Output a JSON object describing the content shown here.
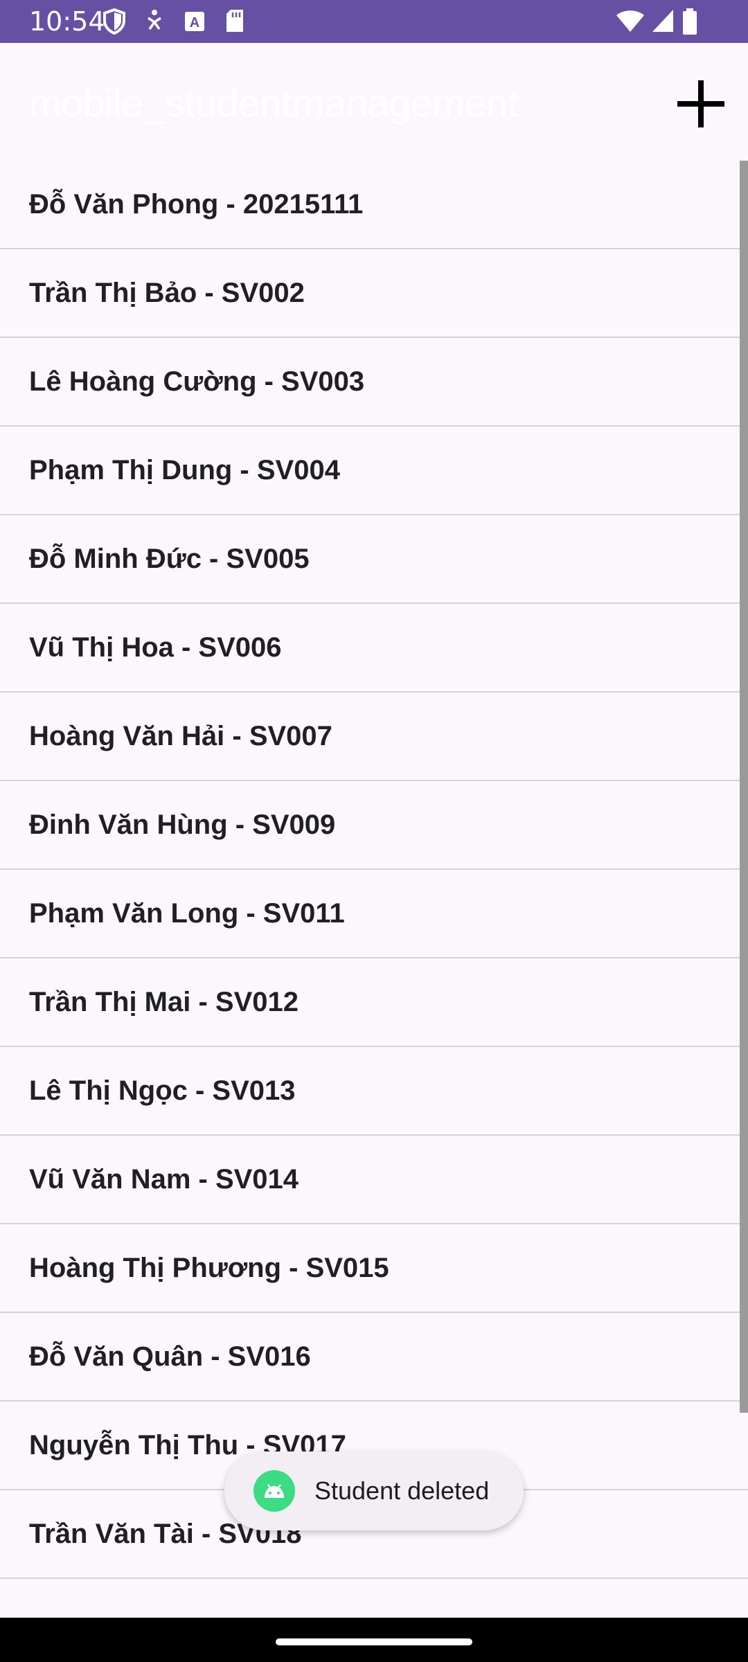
{
  "status_bar": {
    "time": "10:54",
    "left_icons": [
      "shield-icon",
      "accessibility-icon",
      "keyboard-a-icon",
      "sd-card-icon"
    ],
    "right_icons": [
      "wifi-icon",
      "signal-icon",
      "battery-icon"
    ],
    "background": "#6650a4"
  },
  "app_bar": {
    "title": "mobile_studentmanagement",
    "add_icon": "plus-icon"
  },
  "students": [
    {
      "label": "Đỗ Văn Phong - 20215111"
    },
    {
      "label": "Trần Thị Bảo - SV002"
    },
    {
      "label": "Lê Hoàng Cường - SV003"
    },
    {
      "label": "Phạm Thị Dung - SV004"
    },
    {
      "label": "Đỗ Minh Đức - SV005"
    },
    {
      "label": "Vũ Thị Hoa - SV006"
    },
    {
      "label": "Hoàng Văn Hải - SV007"
    },
    {
      "label": "Đinh Văn Hùng - SV009"
    },
    {
      "label": "Phạm Văn Long - SV011"
    },
    {
      "label": "Trần Thị Mai - SV012"
    },
    {
      "label": "Lê Thị Ngọc - SV013"
    },
    {
      "label": "Vũ Văn Nam - SV014"
    },
    {
      "label": "Hoàng Thị Phương - SV015"
    },
    {
      "label": "Đỗ Văn Quân - SV016"
    },
    {
      "label": "Nguyễn Thị Thu - SV017"
    },
    {
      "label": "Trần Văn Tài - SV018"
    }
  ],
  "toast": {
    "message": "Student deleted",
    "icon": "android-icon"
  }
}
